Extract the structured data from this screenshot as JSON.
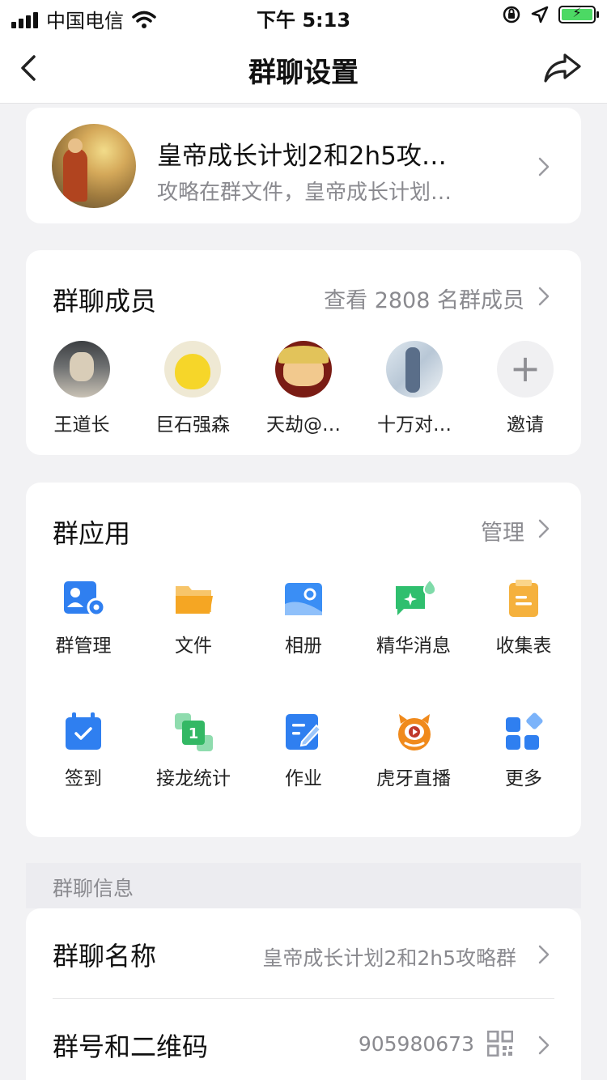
{
  "status_bar": {
    "carrier": "中国电信",
    "time": "下午 5:13"
  },
  "nav": {
    "title": "群聊设置"
  },
  "group": {
    "name": "皇帝成长计划2和2h5攻…",
    "description": "攻略在群文件，皇帝成长计划…"
  },
  "members": {
    "title": "群聊成员",
    "view_all": "查看 2808 名群成员",
    "list": [
      {
        "name": "王道长"
      },
      {
        "name": "巨石强森"
      },
      {
        "name": "天劫@…"
      },
      {
        "name": "十万对…"
      }
    ],
    "invite_label": "邀请"
  },
  "apps": {
    "title": "群应用",
    "manage": "管理",
    "items": [
      {
        "label": "群管理",
        "icon": "group-manage-icon",
        "color": "#2f7ff0"
      },
      {
        "label": "文件",
        "icon": "folder-icon",
        "color": "#f5b13d"
      },
      {
        "label": "相册",
        "icon": "album-icon",
        "color": "#3a8ef5"
      },
      {
        "label": "精华消息",
        "icon": "essence-message-icon",
        "color": "#2fbf6e"
      },
      {
        "label": "收集表",
        "icon": "clipboard-icon",
        "color": "#f5b13d"
      },
      {
        "label": "签到",
        "icon": "calendar-checkin-icon",
        "color": "#2f7ff0"
      },
      {
        "label": "接龙统计",
        "icon": "relay-icon",
        "color": "#33b864"
      },
      {
        "label": "作业",
        "icon": "homework-icon",
        "color": "#2f7ff0"
      },
      {
        "label": "虎牙直播",
        "icon": "huya-live-icon",
        "color": "#f08a1c"
      },
      {
        "label": "更多",
        "icon": "more-apps-icon",
        "color": "#2f7ff0"
      }
    ]
  },
  "info": {
    "section_title": "群聊信息",
    "name_label": "群聊名称",
    "name_value": "皇帝成长计划2和2h5攻略群",
    "number_label": "群号和二维码",
    "number_value": "905980673"
  }
}
